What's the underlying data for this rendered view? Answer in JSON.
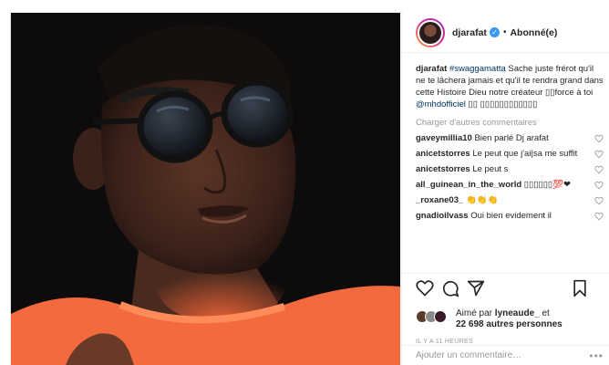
{
  "header": {
    "username": "djarafat",
    "verified_glyph": "✓",
    "separator": "•",
    "follow_status": "Abonné(e)"
  },
  "caption": {
    "username": "djarafat",
    "hashtag": "#swaggamatta",
    "text_1": " Sache juste frérot qu'il ne te lâchera jamais et qu'il te rendra grand dans cette Histoire Dieu notre créateur ▯▯force à toi ",
    "mention": "@mhdofficiel",
    "text_2": " ▯▯ ▯▯▯▯▯▯▯▯▯▯▯▯"
  },
  "load_more": "Charger d'autres commentaires",
  "comments": [
    {
      "user": "gaveymillia10",
      "text": "Bien parlé Dj arafat"
    },
    {
      "user": "anicetstorres",
      "text": "Le peut que j'ai|sa me suffit"
    },
    {
      "user": "anicetstorres",
      "text": "Le peut s"
    },
    {
      "user": "all_guinean_in_the_world",
      "text": "▯▯▯▯▯▯💯❤"
    },
    {
      "user": "_roxane03_",
      "text": "👏👏👏"
    },
    {
      "user": "gnadioilvass",
      "text": "Oui bien evidement il"
    }
  ],
  "likes": {
    "line_1_prefix": "Aimé par ",
    "line_1_user": "lyneaude_",
    "line_1_suffix": " et",
    "line_2_count": "22 698",
    "line_2_suffix": " autres personnes"
  },
  "timestamp": "IL Y A 11 HEURES",
  "add_comment": {
    "placeholder": "Ajouter un commentaire…",
    "more": "•••"
  },
  "icons": [
    "heart-icon",
    "comment-icon",
    "share-icon",
    "bookmark-icon",
    "verified-icon",
    "more-options-icon"
  ],
  "colors": {
    "link": "#003569",
    "verified": "#3897f0",
    "muted": "#999999",
    "shirt": "#f26a3d",
    "background_photo": "#0d0b0c"
  }
}
